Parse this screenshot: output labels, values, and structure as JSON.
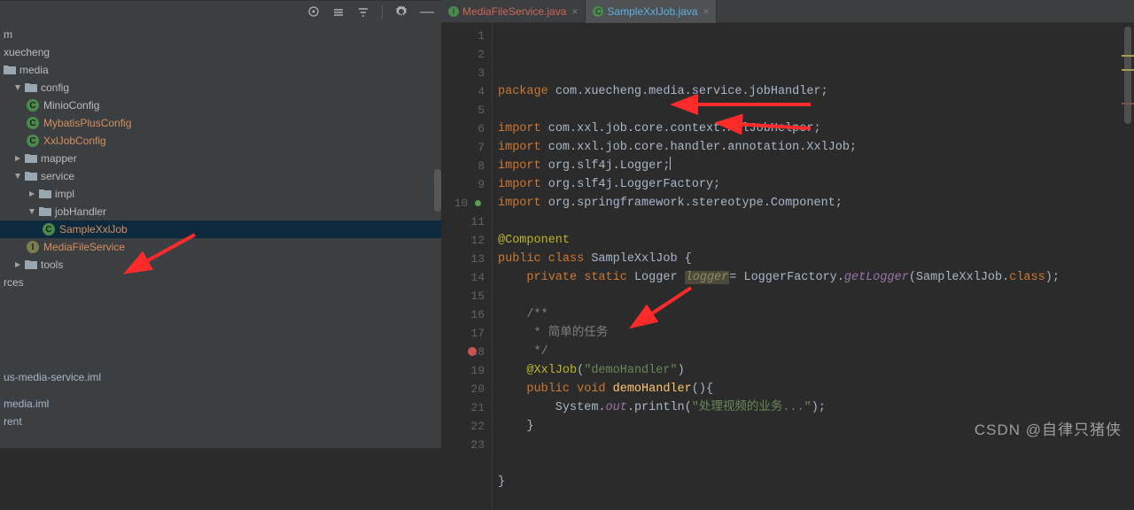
{
  "tabs": {
    "t1": "MediaFileService.java",
    "t2": "SampleXxlJob.java"
  },
  "tree": {
    "n_m": "m",
    "n_xuecheng": "xuecheng",
    "n_media": "media",
    "n_config": "config",
    "n_minio": "MinioConfig",
    "n_mybatis": "MybatisPlusConfig",
    "n_xxl": "XxlJobConfig",
    "n_mapper": "mapper",
    "n_service": "service",
    "n_impl": "impl",
    "n_jobhandler": "jobHandler",
    "n_sample": "SampleXxlJob",
    "n_mediafilesvc": "MediaFileService",
    "n_tools": "tools",
    "n_rces": "rces",
    "n_iml1": "us-media-service.iml",
    "n_iml2": "media.iml",
    "n_rent": "rent"
  },
  "code": {
    "l1": [
      "package ",
      "com.xuecheng.media.service.jobHandler;"
    ],
    "l3": [
      "import ",
      "com.xxl.job.core.context.XxlJobHelper;"
    ],
    "l4a": "import ",
    "l4b": "com.xxl.job.core.handler.annotation.",
    "l4c": "XxlJob",
    "l4d": ";",
    "l5": [
      "import ",
      "org.slf4j.Logger;"
    ],
    "l6": [
      "import ",
      "org.slf4j.LoggerFactory;"
    ],
    "l7a": "import ",
    "l7b": "org.springframework.stereotype.",
    "l7c": "Component",
    "l7d": ";",
    "l9": "@Component",
    "l10a": "public class ",
    "l10b": "SampleXxlJob ",
    "l10c": "{",
    "l11a": "    private static ",
    "l11b": "Logger ",
    "l11c": "logger",
    "l11d": "= LoggerFactory.",
    "l11e": "getLogger",
    "l11f": "(SampleXxlJob.",
    "l11g": "class",
    "l11h": ");",
    "l13": "    /**",
    "l14": "     * 简单的任务",
    "l15": "     */",
    "l16a": "    @XxlJob",
    "l16b": "(",
    "l16c": "\"demoHandler\"",
    "l16d": ")",
    "l17a": "    public void ",
    "l17b": "demoHandler",
    "l17c": "(){",
    "l18a": "        System.",
    "l18b": "out",
    "l18c": ".println(",
    "l18d": "\"处理视频的业务...\"",
    "l18e": ");",
    "l19": "    }",
    "l22": "}"
  },
  "watermark": "CSDN @自律只猪侠"
}
